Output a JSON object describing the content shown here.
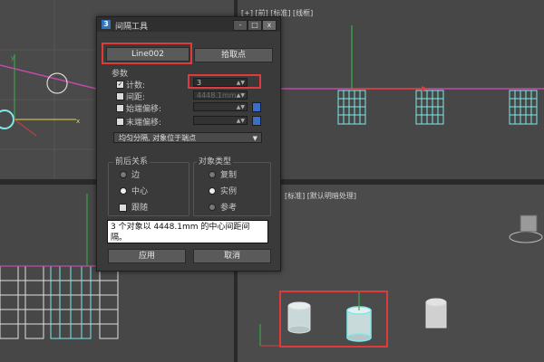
{
  "viewports": {
    "top_right_label": "[+] [前] [标准] [线框]",
    "bottom_right_label": "[标准] [默认明暗处理]"
  },
  "dialog": {
    "title": "间隔工具",
    "title_icon": "3",
    "window_buttons": [
      "-",
      "□",
      "x"
    ],
    "pick_path_button": "Line002",
    "pick_points_button": "拾取点",
    "params_group": "参数",
    "count": {
      "label": "计数:",
      "checked": true,
      "value": "3"
    },
    "spacing": {
      "label": "间距:",
      "checked": false,
      "value": "4448.1mm"
    },
    "start_offset": {
      "label": "始端偏移:",
      "checked": false,
      "value": ""
    },
    "end_offset": {
      "label": "末端偏移:",
      "checked": false,
      "value": ""
    },
    "distribution": "均匀分隔, 对象位于端点",
    "context": {
      "title": "前后关系",
      "options": [
        "边",
        "中心",
        "跟随"
      ],
      "selected": "中心"
    },
    "object_type": {
      "title": "对象类型",
      "options": [
        "复制",
        "实例",
        "参考"
      ],
      "selected": "实例"
    },
    "status_text": "3 个对象以 4448.1mm 的中心间距间隔。",
    "apply_button": "应用",
    "cancel_button": "取消"
  },
  "colors": {
    "highlight": "#e03a3a",
    "selection": "#7fe9e9",
    "viewport_bg": "#444444"
  }
}
